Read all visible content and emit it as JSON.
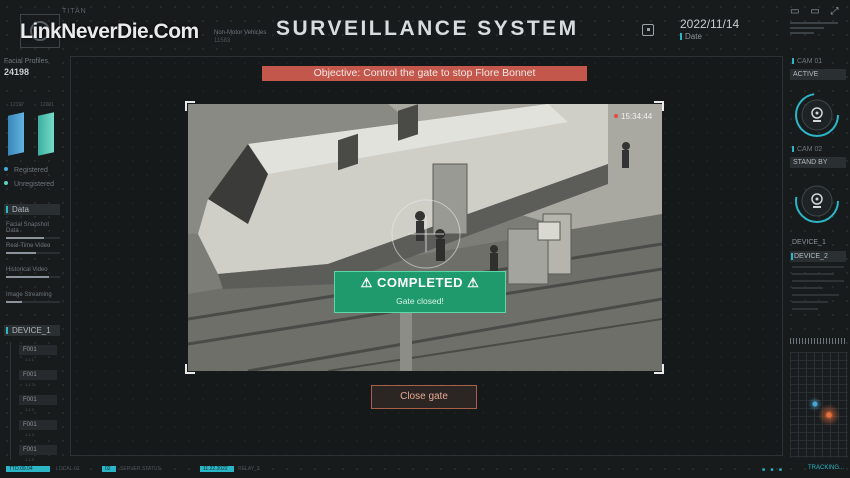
{
  "header": {
    "brand": "TITAN",
    "watermark": "LinkNeverDie.Com",
    "non_motor_label": "Non-Motor Vehicles",
    "non_motor_value": "11583",
    "title": "SURVEILLANCE SYSTEM",
    "date_value": "2022/11/14",
    "date_label": "Date",
    "window_icons": "▭ ▭ ⤢"
  },
  "left_panel": {
    "facial_label": "Facial Profiles",
    "facial_count": "24198",
    "bar_left_caption": "12197",
    "bar_right_caption": "12001",
    "legend_registered": "Registered",
    "legend_unregistered": "Unregistered",
    "data_header": "Data",
    "data_items": [
      {
        "label": "Facial Snapshot Data",
        "fill": 0.7
      },
      {
        "label": "Real-Time Video",
        "fill": 0.55
      },
      {
        "label": "Historical Video",
        "fill": 0.8
      },
      {
        "label": "Image Streaming",
        "fill": 0.3
      }
    ],
    "device_header": "DEVICE_1",
    "devices": [
      "F001",
      "F001",
      "F001",
      "F001",
      "F001"
    ],
    "device_subs": [
      "1.1.1",
      "1.1.2",
      "1.1.3",
      "1.1.4",
      "1.1.5"
    ]
  },
  "objective": "Objective: Control the gate to stop Flore Bonnet",
  "feed": {
    "timestamp": "15:34:44"
  },
  "completed": {
    "title": "⚠ COMPLETED ⚠",
    "subtitle": "Gate closed!"
  },
  "actions": {
    "close_gate": "Close gate"
  },
  "right_panel": {
    "cam1_label": "CAM 01",
    "cam1_status": "ACTIVE",
    "cam2_label": "CAM 02",
    "cam2_status": "STAND BY",
    "device1": "DEVICE_1",
    "device2": "DEVICE_2",
    "ring_color": "#2bb6c8"
  },
  "footer": {
    "chip1": "TTD.09.04",
    "txt1": "LOCAL-01",
    "chip2": "02",
    "txt2": "SERVER.STATUS",
    "chip3": "11.22.2022",
    "txt3": "RELAY_3",
    "tracking": "TRACKING..."
  },
  "colors": {
    "accent": "#2bb6c8",
    "objective_bg": "#c4574b",
    "completed_bg": "#1f9a6c",
    "button_border": "#a7604a"
  }
}
